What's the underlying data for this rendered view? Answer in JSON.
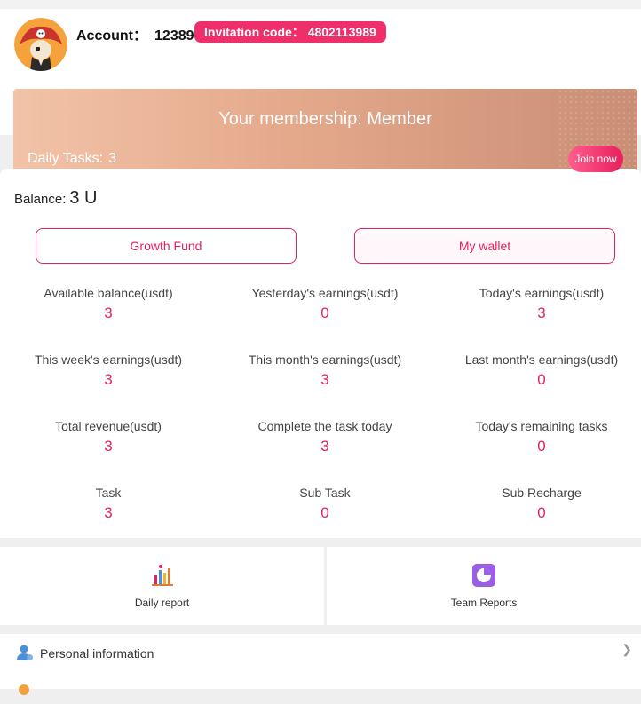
{
  "header": {
    "account_label": "Account：",
    "account_value": "12389",
    "invitation_label": "Invitation code：",
    "invitation_value": "4802113989"
  },
  "banner": {
    "title": "Your membership: Member",
    "daily_tasks_label": "Daily Tasks:",
    "daily_tasks_value": "3",
    "join_label": "Join now"
  },
  "balance": {
    "label": "Balance:",
    "value": "3 U"
  },
  "buttons": {
    "growth_fund": "Growth Fund",
    "my_wallet": "My wallet"
  },
  "stats": [
    {
      "label": "Available balance(usdt)",
      "value": "3"
    },
    {
      "label": "Yesterday's earnings(usdt)",
      "value": "0"
    },
    {
      "label": "Today's earnings(usdt)",
      "value": "3"
    },
    {
      "label": "This week's earnings(usdt)",
      "value": "3"
    },
    {
      "label": "This month's earnings(usdt)",
      "value": "3"
    },
    {
      "label": "Last month's earnings(usdt)",
      "value": "0"
    },
    {
      "label": "Total revenue(usdt)",
      "value": "3"
    },
    {
      "label": "Complete the task today",
      "value": "3"
    },
    {
      "label": "Today's remaining tasks",
      "value": "0"
    },
    {
      "label": "Task",
      "value": "3"
    },
    {
      "label": "Sub Task",
      "value": "0"
    },
    {
      "label": "Sub Recharge",
      "value": "0"
    }
  ],
  "reports": {
    "daily": {
      "label": "Daily report",
      "icon": "bar-chart-icon"
    },
    "team": {
      "label": "Team Reports",
      "icon": "pie-chart-icon"
    }
  },
  "menu": {
    "personal_info": {
      "label": "Personal information",
      "icon": "user-icon"
    }
  },
  "colors": {
    "accent": "#e0245e",
    "invite_bg": "#ef2f6a",
    "team_icon": "#9b5de5"
  }
}
